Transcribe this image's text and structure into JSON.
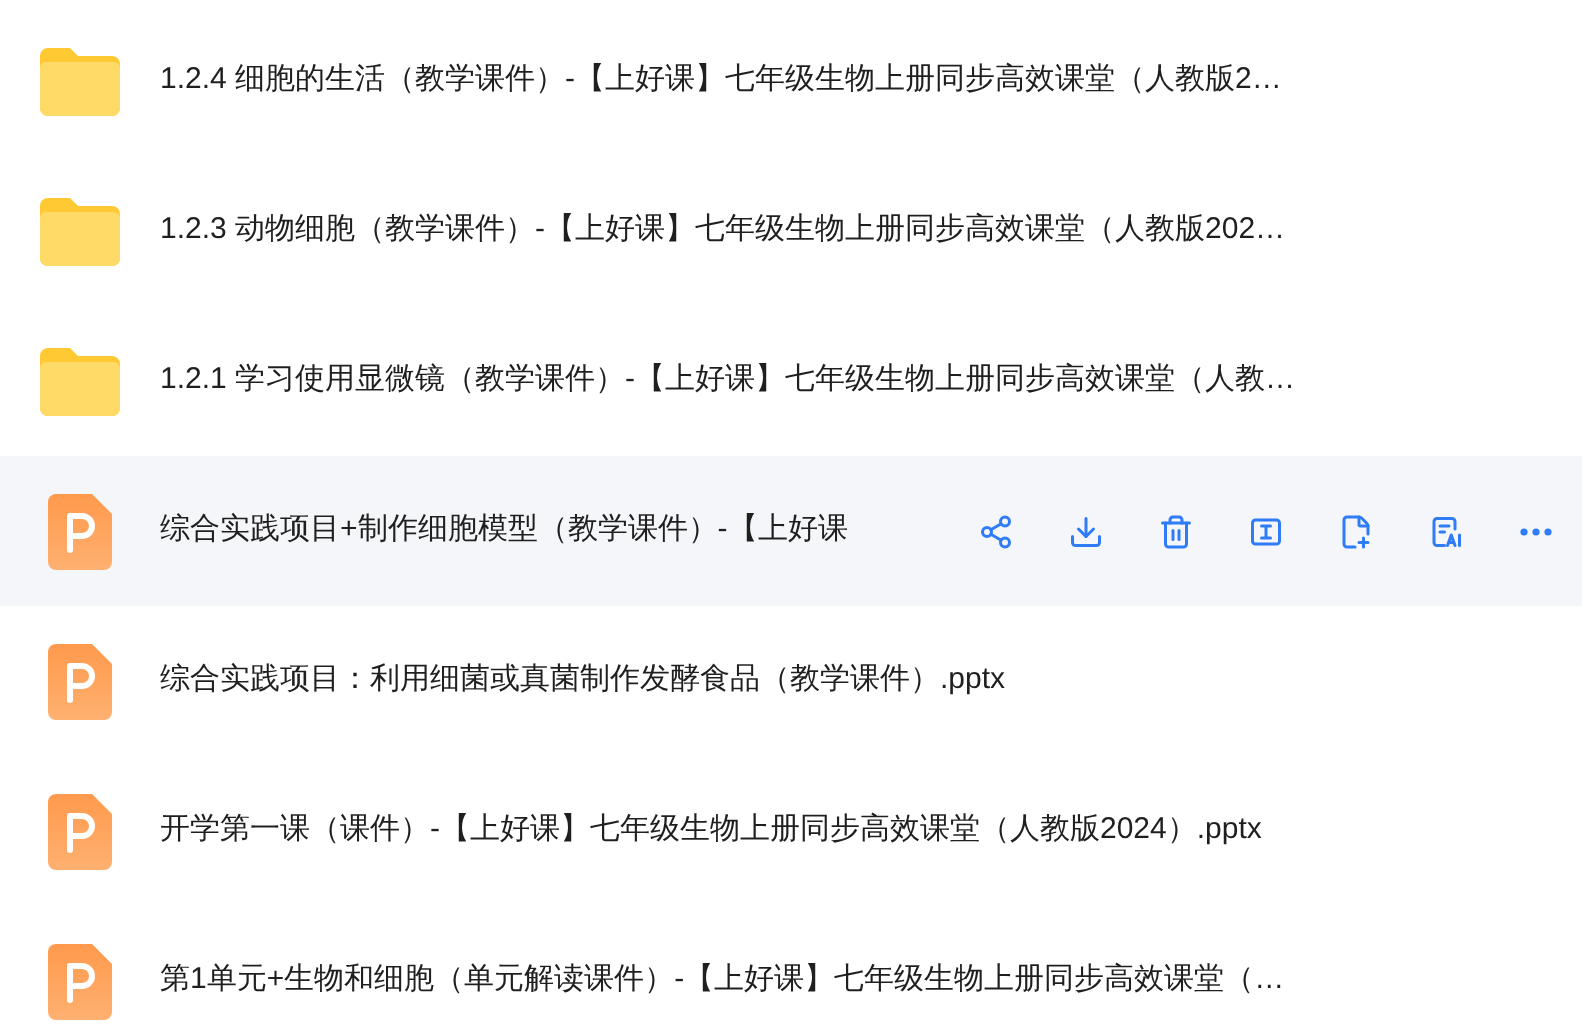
{
  "files": [
    {
      "kind": "folder",
      "name": "1.2.4 细胞的生活（教学课件）-【上好课】七年级生物上册同步高效课堂（人教版2…",
      "hovered": false
    },
    {
      "kind": "folder",
      "name": "1.2.3 动物细胞（教学课件）-【上好课】七年级生物上册同步高效课堂（人教版202…",
      "hovered": false
    },
    {
      "kind": "folder",
      "name": "1.2.1 学习使用显微镜（教学课件）-【上好课】七年级生物上册同步高效课堂（人教…",
      "hovered": false
    },
    {
      "kind": "pptx",
      "name": "综合实践项目+制作细胞模型（教学课件）-【上好课",
      "hovered": true
    },
    {
      "kind": "pptx",
      "name": "综合实践项目：利用细菌或真菌制作发酵食品（教学课件）.pptx",
      "hovered": false
    },
    {
      "kind": "pptx",
      "name": "开学第一课（课件）-【上好课】七年级生物上册同步高效课堂（人教版2024）.pptx",
      "hovered": false
    },
    {
      "kind": "pptx",
      "name": "第1单元+生物和细胞（单元解读课件）-【上好课】七年级生物上册同步高效课堂（…",
      "hovered": false
    }
  ]
}
